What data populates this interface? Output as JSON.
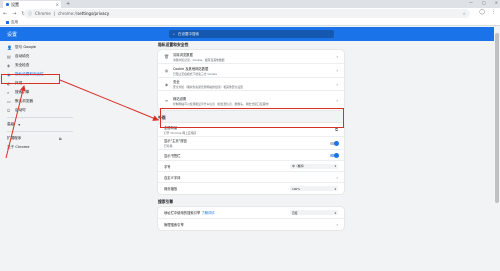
{
  "tab": {
    "title": "设置",
    "close": "×"
  },
  "new_tab": "+",
  "window_controls": [
    "—",
    "□",
    "×"
  ],
  "omnibox": {
    "secure_label": "Chrome",
    "separator": "|",
    "url_host": "chrome://",
    "url_path": "settings/privacy",
    "star": "☆"
  },
  "bookmarks": {
    "apps_label": "应用"
  },
  "header": {
    "title": "设置",
    "search_placeholder": "在设置中搜索"
  },
  "sidebar": {
    "items": [
      {
        "label": "您与 Google",
        "icon": "person-icon",
        "glyph": "👤"
      },
      {
        "label": "自动填充",
        "icon": "clipboard-icon",
        "glyph": "▤"
      },
      {
        "label": "安全检查",
        "icon": "shield-check-icon",
        "glyph": "◈"
      },
      {
        "label": "隐私设置和安全性",
        "icon": "shield-icon",
        "glyph": "◉",
        "active": true
      },
      {
        "label": "外观",
        "icon": "palette-icon",
        "glyph": "◐"
      },
      {
        "label": "搜索引擎",
        "icon": "search-icon",
        "glyph": "⌕"
      },
      {
        "label": "默认浏览器",
        "icon": "browser-icon",
        "glyph": "▭"
      },
      {
        "label": "启动时",
        "icon": "power-icon",
        "glyph": "⏻"
      }
    ],
    "advanced": "高级",
    "extensions": "扩展程序",
    "about": "关于 Chrome"
  },
  "privacy": {
    "section_title": "隐私设置和安全性",
    "rows": [
      {
        "icon": "trash-icon",
        "glyph": "🗑",
        "title": "清除浏览数据",
        "sub": "清除浏览记录、Cookie、缓存及其他数据"
      },
      {
        "icon": "cookie-icon",
        "glyph": "◍",
        "title": "Cookie 及其他网站数据",
        "sub": "已阻止无痕模式下的第三方 Cookie"
      },
      {
        "icon": "shield-icon",
        "glyph": "◈",
        "title": "安全",
        "sub": "安全浏览（保护您免受危险网站的侵害）和其他安全设置"
      },
      {
        "icon": "sliders-icon",
        "glyph": "≡",
        "title": "网站设置",
        "sub": "控制网站可以使用和显示什么信息（如位置信息、摄像头、弹出式窗口及其他）"
      }
    ]
  },
  "appearance": {
    "section_title": "外观",
    "rows": [
      {
        "title": "主题背景",
        "sub": "打开 Chrome 网上应用店"
      },
      {
        "title": "显示\"主页\"按钮",
        "sub": "已停用"
      },
      {
        "title": "显示书签栏"
      },
      {
        "title": "字号",
        "value": "中（推荐）"
      },
      {
        "title": "自定义字体"
      },
      {
        "title": "网页缩放",
        "value": "100%"
      }
    ]
  },
  "search_engine": {
    "section_title": "搜索引擎",
    "rows": [
      {
        "title": "地址栏中使用的搜索引擎",
        "link": "了解详情",
        "value": "百度"
      },
      {
        "title": "管理搜索引擎"
      }
    ]
  },
  "colors": {
    "accent": "#1a73e8",
    "highlight": "#d93025"
  }
}
